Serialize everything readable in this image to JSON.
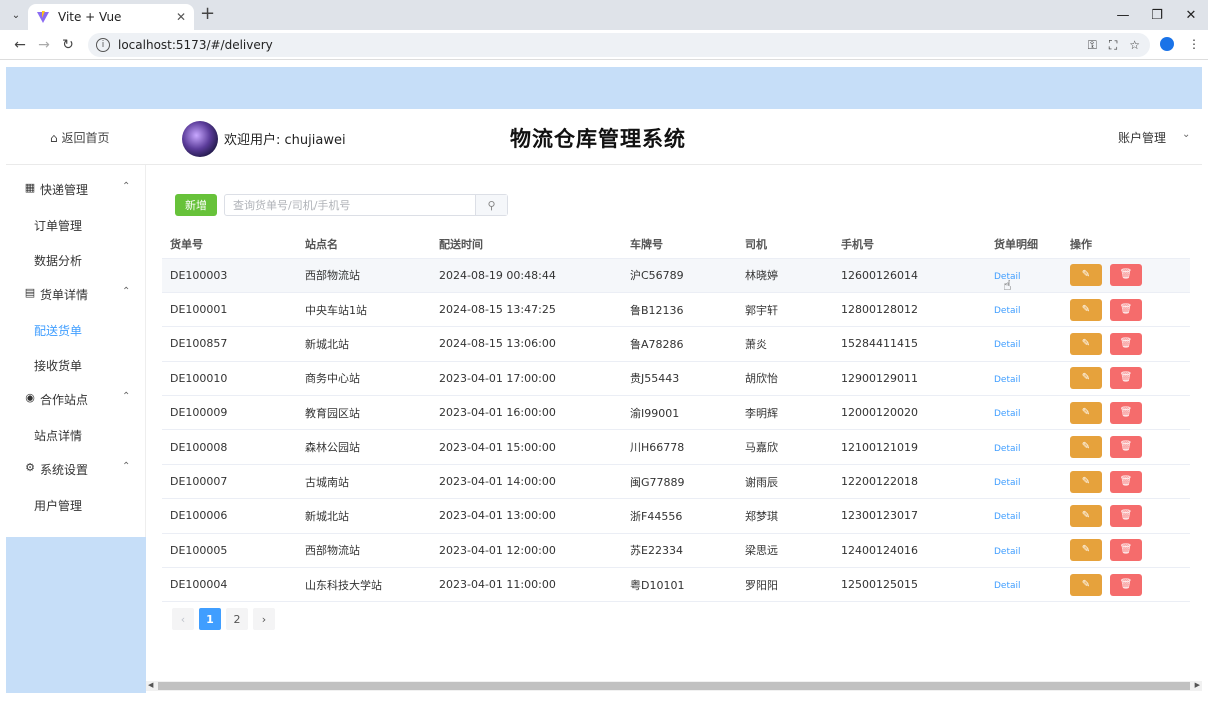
{
  "browser": {
    "tab_title": "Vite + Vue",
    "url": "localhost:5173/#/delivery"
  },
  "header": {
    "home_link": "返回首页",
    "welcome": "欢迎用户: chujiawei",
    "app_title": "物流仓库管理系统",
    "account_menu": "账户管理"
  },
  "sidebar": {
    "groups": [
      {
        "label": "快递管理",
        "icon": "grid-icon",
        "items": [
          {
            "label": "订单管理"
          },
          {
            "label": "数据分析"
          }
        ]
      },
      {
        "label": "货单详情",
        "icon": "document-icon",
        "items": [
          {
            "label": "配送货单"
          },
          {
            "label": "接收货单"
          }
        ]
      },
      {
        "label": "合作站点",
        "icon": "location-pin-icon",
        "items": [
          {
            "label": "站点详情"
          }
        ]
      },
      {
        "label": "系统设置",
        "icon": "gear-icon",
        "items": [
          {
            "label": "用户管理"
          }
        ]
      }
    ],
    "active_item": "配送货单"
  },
  "toolbar": {
    "add_label": "新增",
    "search_placeholder": "查询货单号/司机/手机号"
  },
  "table": {
    "columns": [
      "货单号",
      "站点名",
      "配送时间",
      "车牌号",
      "司机",
      "手机号",
      "货单明细",
      "操作"
    ],
    "detail_label": "Detail",
    "rows": [
      {
        "id": "DE100003",
        "station": "西部物流站",
        "time": "2024-08-19 00:48:44",
        "plate": "沪C56789",
        "driver": "林晓婷",
        "phone": "12600126014"
      },
      {
        "id": "DE100001",
        "station": "中央车站1站",
        "time": "2024-08-15 13:47:25",
        "plate": "鲁B12136",
        "driver": "郭宇轩",
        "phone": "12800128012"
      },
      {
        "id": "DE100857",
        "station": "新城北站",
        "time": "2024-08-15 13:06:00",
        "plate": "鲁A78286",
        "driver": "萧炎",
        "phone": "15284411415"
      },
      {
        "id": "DE100010",
        "station": "商务中心站",
        "time": "2023-04-01 17:00:00",
        "plate": "贵J55443",
        "driver": "胡欣怡",
        "phone": "12900129011"
      },
      {
        "id": "DE100009",
        "station": "教育园区站",
        "time": "2023-04-01 16:00:00",
        "plate": "渝I99001",
        "driver": "李明辉",
        "phone": "12000120020"
      },
      {
        "id": "DE100008",
        "station": "森林公园站",
        "time": "2023-04-01 15:00:00",
        "plate": "川H66778",
        "driver": "马嘉欣",
        "phone": "12100121019"
      },
      {
        "id": "DE100007",
        "station": "古城南站",
        "time": "2023-04-01 14:00:00",
        "plate": "闽G77889",
        "driver": "谢雨辰",
        "phone": "12200122018"
      },
      {
        "id": "DE100006",
        "station": "新城北站",
        "time": "2023-04-01 13:00:00",
        "plate": "浙F44556",
        "driver": "郑梦琪",
        "phone": "12300123017"
      },
      {
        "id": "DE100005",
        "station": "西部物流站",
        "time": "2023-04-01 12:00:00",
        "plate": "苏E22334",
        "driver": "梁思远",
        "phone": "12400124016"
      },
      {
        "id": "DE100004",
        "station": "山东科技大学站",
        "time": "2023-04-01 11:00:00",
        "plate": "粤D10101",
        "driver": "罗阳阳",
        "phone": "12500125015"
      }
    ]
  },
  "pagination": {
    "pages": [
      "1",
      "2"
    ],
    "current": "1"
  },
  "colors": {
    "accent": "#409eff",
    "add_button": "#67c23a",
    "edit_button": "#e6a23c",
    "delete_button": "#f56c6c",
    "banner": "#c6def8"
  }
}
